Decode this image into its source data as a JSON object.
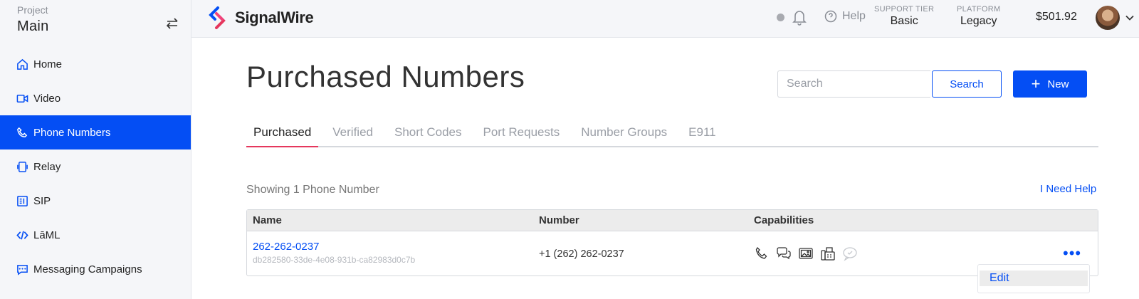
{
  "sidebar": {
    "project_label": "Project",
    "project_name": "Main",
    "switch_icon": "swap-arrows-icon",
    "items": [
      {
        "label": "Home",
        "icon": "home-icon",
        "active": false
      },
      {
        "label": "Video",
        "icon": "video-icon",
        "active": false
      },
      {
        "label": "Phone Numbers",
        "icon": "phone-icon",
        "active": true
      },
      {
        "label": "Relay",
        "icon": "relay-icon",
        "active": false
      },
      {
        "label": "SIP",
        "icon": "sip-icon",
        "active": false
      },
      {
        "label": "LāML",
        "icon": "code-icon",
        "active": false
      },
      {
        "label": "Messaging Campaigns",
        "icon": "message-icon",
        "active": false
      }
    ]
  },
  "header": {
    "brand": "SignalWire",
    "help_label": "Help",
    "support_tier_label": "SUPPORT TIER",
    "support_tier_value": "Basic",
    "platform_label": "PLATFORM",
    "platform_value": "Legacy",
    "balance": "$501.92"
  },
  "page": {
    "title": "Purchased Numbers",
    "search_placeholder": "Search",
    "search_button": "Search",
    "new_button": "New",
    "tabs": [
      {
        "label": "Purchased",
        "active": true
      },
      {
        "label": "Verified",
        "active": false
      },
      {
        "label": "Short Codes",
        "active": false
      },
      {
        "label": "Port Requests",
        "active": false
      },
      {
        "label": "Number Groups",
        "active": false
      },
      {
        "label": "E911",
        "active": false
      }
    ],
    "showing_text": "Showing 1 Phone Number",
    "need_help": "I Need Help"
  },
  "table": {
    "columns": [
      "Name",
      "Number",
      "Capabilities"
    ],
    "rows": [
      {
        "name": "262-262-0237",
        "sid": "db282580-33de-4e08-931b-ca82983d0c7b",
        "number": "+1 (262) 262-0237",
        "capabilities": [
          "voice-icon",
          "messaging-icon",
          "mms-icon",
          "fax-icon",
          "chat-icon"
        ],
        "more_label": "•••"
      }
    ]
  },
  "dropdown": {
    "items": [
      "Edit"
    ]
  },
  "colors": {
    "accent": "#044ef4",
    "tab_underline": "#e5375d",
    "sidebar_bg": "#f5f6f9"
  }
}
